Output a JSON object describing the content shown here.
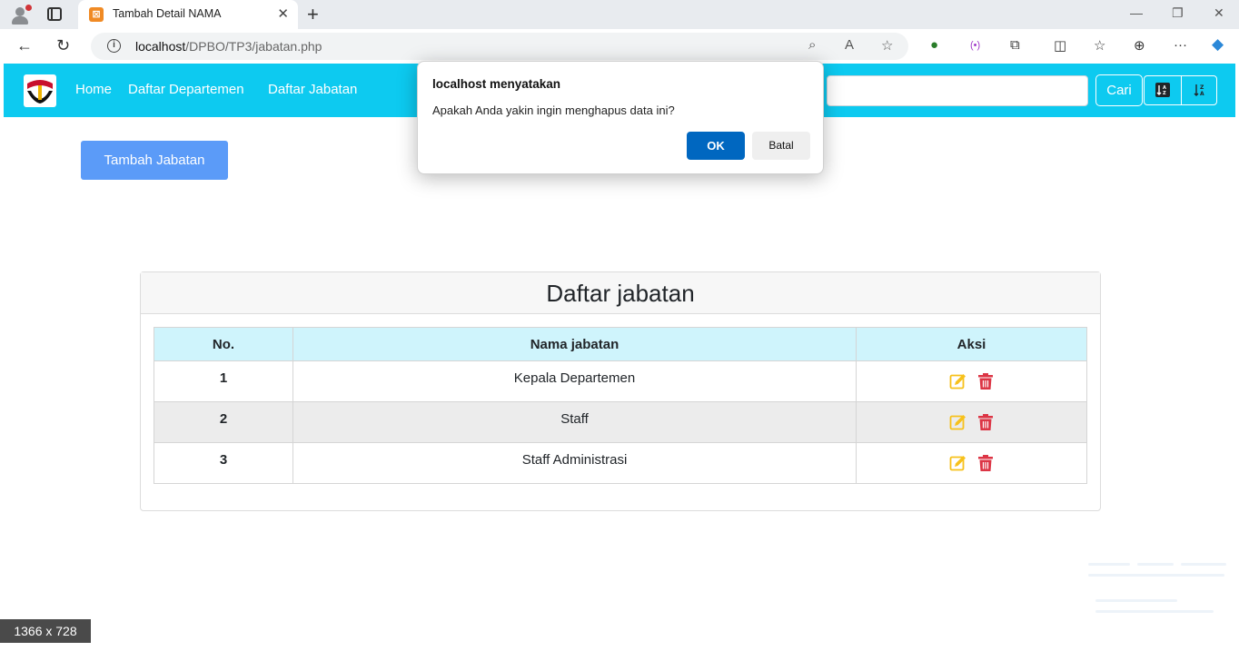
{
  "browser": {
    "tab_title": "Tambah Detail NAMA",
    "url_host": "localhost",
    "url_path": "/DPBO/TP3/jabatan.php"
  },
  "navbar": {
    "links": [
      "Home",
      "Daftar Departemen",
      "Daftar Jabatan"
    ],
    "search_placeholder": "",
    "search_button": "Cari",
    "bg_color": "#0dcaf0"
  },
  "main": {
    "add_button": "Tambah Jabatan",
    "card_title": "Daftar jabatan",
    "table": {
      "headers": [
        "No.",
        "Nama jabatan",
        "Aksi"
      ],
      "rows": [
        {
          "no": "1",
          "nama": "Kepala Departemen"
        },
        {
          "no": "2",
          "nama": "Staff"
        },
        {
          "no": "3",
          "nama": "Staff Administrasi"
        }
      ]
    }
  },
  "dialog": {
    "title": "localhost menyatakan",
    "message": "Apakah Anda yakin ingin menghapus data ini?",
    "ok_label": "OK",
    "cancel_label": "Batal"
  },
  "overlay": {
    "size_label": "1366 x 728"
  }
}
